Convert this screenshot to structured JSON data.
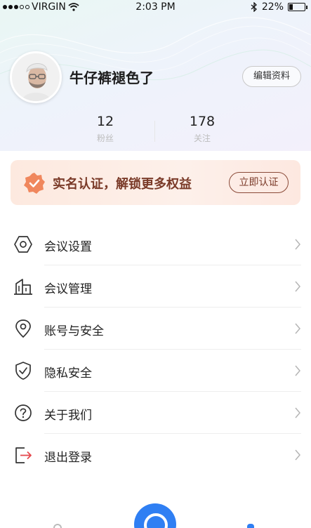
{
  "status_bar": {
    "carrier": "VIRGIN",
    "time": "2:03 PM",
    "battery_percent": "22%",
    "battery_level": 0.22,
    "icons": [
      "signal-dots-icon",
      "wifi-icon",
      "bluetooth-icon",
      "battery-icon"
    ]
  },
  "profile": {
    "username": "牛仔裤褪色了",
    "edit_button": "编辑资料",
    "avatar_icon": "avatar"
  },
  "stats": [
    {
      "value": "12",
      "label": "粉丝"
    },
    {
      "value": "178",
      "label": "关注"
    }
  ],
  "verify_banner": {
    "text": "实名认证，解锁更多权益",
    "button": "立即认证",
    "icon": "verified-badge-icon",
    "accent_color": "#f0875d"
  },
  "menu": [
    {
      "label": "会议设置",
      "icon": "hexagon-settings-icon"
    },
    {
      "label": "会议管理",
      "icon": "building-icon"
    },
    {
      "label": "账号与安全",
      "icon": "location-pin-icon"
    },
    {
      "label": "隐私安全",
      "icon": "shield-check-icon"
    },
    {
      "label": "关于我们",
      "icon": "question-circle-icon"
    },
    {
      "label": "退出登录",
      "icon": "logout-icon"
    }
  ],
  "colors": {
    "primary": "#2f7ff3",
    "logout_arrow": "#e5484d",
    "banner_text": "#7a3a28"
  }
}
